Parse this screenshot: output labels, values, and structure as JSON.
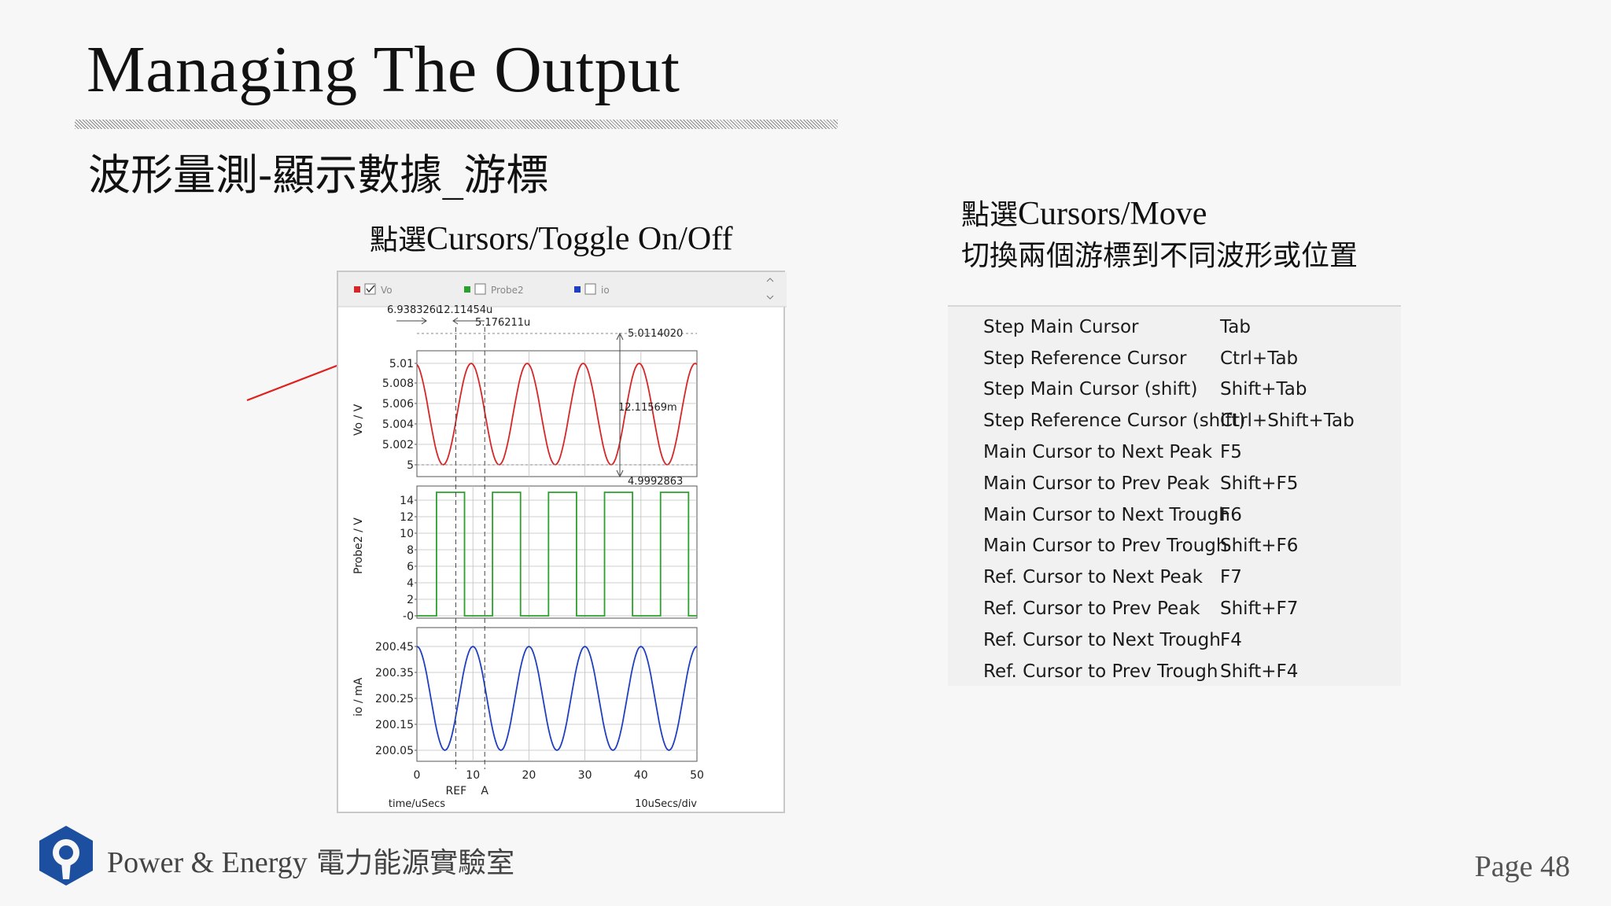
{
  "slide": {
    "title": "Managing The Output",
    "subtitle": "波形量測-顯示數據_游標",
    "caption_toggle_cjk": "點選",
    "caption_toggle_latin": "Cursors/Toggle On/Off",
    "caption_move_line1_cjk": "點選",
    "caption_move_line1_latin": "Cursors/Move",
    "caption_move_line2": "切換兩個游標到不同波形或位置",
    "footer_latin": "Power & Energy",
    "footer_cjk": "電力能源實驗室",
    "page": "Page 48"
  },
  "colors": {
    "vo": "#d62728",
    "probe2": "#2ca02c",
    "io": "#1f3fbf",
    "arrow": "#e0201f",
    "logo": "#1d4fa0"
  },
  "plot": {
    "legend": [
      {
        "name": "Vo",
        "color": "#d62728",
        "checked": true
      },
      {
        "name": "Probe2",
        "color": "#2ca02c",
        "checked": false
      },
      {
        "name": "io",
        "color": "#1f3fbf",
        "checked": false
      }
    ],
    "cursor_readouts": {
      "main_x": "6.938326u",
      "ref_x": "12.11454u",
      "delta_x": "5.176211u",
      "top_value": "5.0114020",
      "delta_y": "12.11569m",
      "bottom_value": "4.9992863"
    },
    "vo_axis": {
      "label": "Vo / V",
      "ticks": [
        "5.01",
        "5.008",
        "5.006",
        "5.004",
        "5.002",
        "5"
      ]
    },
    "probe2_axis": {
      "label": "Probe2 / V",
      "ticks": [
        "14",
        "12",
        "10",
        "8",
        "6",
        "4",
        "2",
        "-0"
      ]
    },
    "io_axis": {
      "label": "io / mA",
      "ticks": [
        "200.45",
        "200.35",
        "200.25",
        "200.15",
        "200.05"
      ]
    },
    "x_ticks": [
      "0",
      "10",
      "20",
      "30",
      "40",
      "50"
    ],
    "x_ref_label": "REF",
    "x_a_label": "A",
    "x_axis_label": "time/uSecs",
    "x_div_label": "10uSecs/div"
  },
  "shortcuts": [
    {
      "action": "Step Main Cursor",
      "key": "Tab"
    },
    {
      "action": "Step Reference Cursor",
      "key": "Ctrl+Tab"
    },
    {
      "action": "Step Main Cursor (shift)",
      "key": "Shift+Tab"
    },
    {
      "action": "Step Reference Cursor (shift)",
      "key": "Ctrl+Shift+Tab"
    },
    {
      "action": "Main Cursor to Next Peak",
      "key": "F5"
    },
    {
      "action": "Main Cursor to Prev Peak",
      "key": "Shift+F5"
    },
    {
      "action": "Main Cursor to Next Trough",
      "key": "F6"
    },
    {
      "action": "Main Cursor to Prev Trough",
      "key": "Shift+F6"
    },
    {
      "action": "Ref. Cursor to Next Peak",
      "key": "F7"
    },
    {
      "action": "Ref. Cursor to Prev Peak",
      "key": "Shift+F7"
    },
    {
      "action": "Ref. Cursor to Next Trough",
      "key": "F4"
    },
    {
      "action": "Ref. Cursor to Prev Trough",
      "key": "Shift+F4"
    }
  ]
}
